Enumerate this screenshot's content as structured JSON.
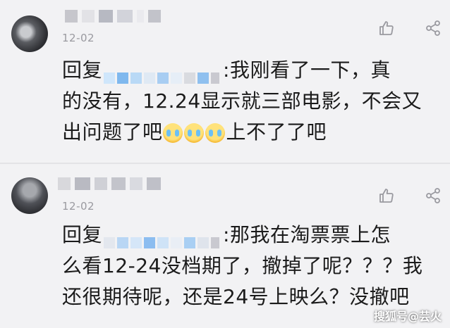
{
  "comments": [
    {
      "date": "12-02",
      "reply_prefix": "回复",
      "reply_suffix": ":我刚看了一下，真",
      "line2": "的没有，12.24显示就三部电影，不会又",
      "line3_start": "出问题了吧",
      "line3_end": "上不了了吧"
    },
    {
      "date": "12-02",
      "reply_prefix": "回复",
      "reply_suffix": ":那我在淘票票上怎",
      "line2": "么看12-24没档期了，撤掉了呢？？？我",
      "line3": "还很期待呢，还是24号上映么？没撤吧"
    }
  ],
  "watermark": "搜狐号@芸火",
  "icons": [
    "avatar",
    "like-icon",
    "share-icon",
    "crying-emoji"
  ],
  "colors": {
    "background": "#f2f2f4",
    "date": "#9a9aa0",
    "icon": "#9a9aa0",
    "mask_blue": "#7fb8ee",
    "mask_gray": "#c9c9d0"
  }
}
